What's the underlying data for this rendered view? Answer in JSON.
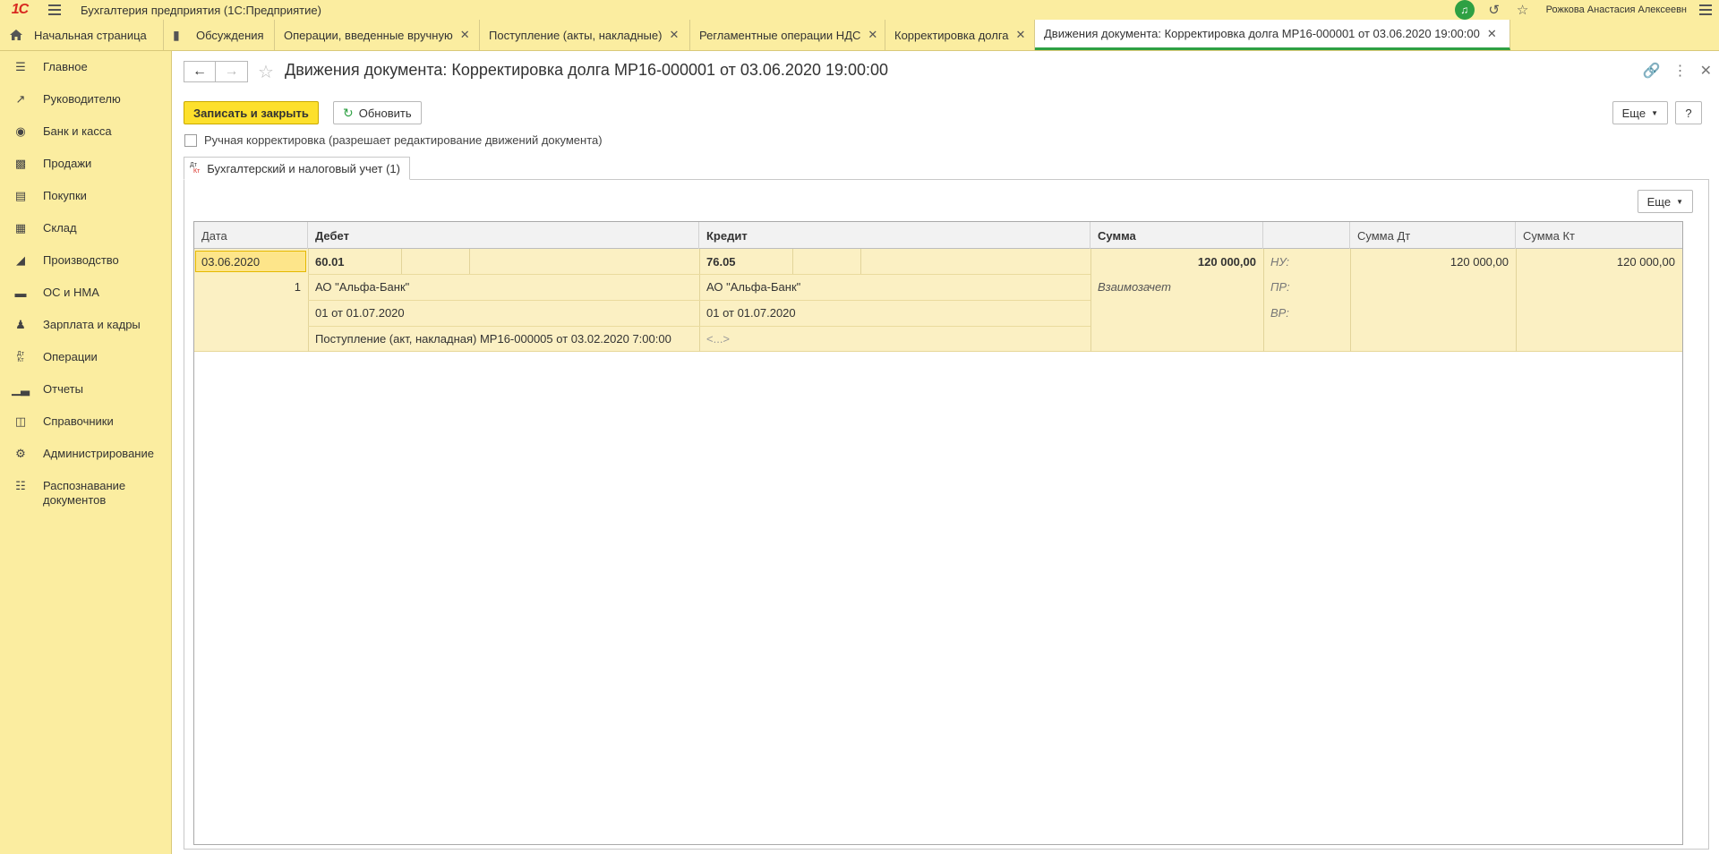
{
  "app": {
    "logo": "1С",
    "title": "Бухгалтерия предприятия  (1С:Предприятие)",
    "user": "Рожкова Анастасия Алексеевн"
  },
  "tabs": [
    {
      "label": "Начальная страница"
    },
    {
      "label": "Обсуждения"
    },
    {
      "label": "Операции, введенные вручную"
    },
    {
      "label": "Поступление (акты, накладные)"
    },
    {
      "label": "Регламентные операции НДС"
    },
    {
      "label": "Корректировка долга"
    },
    {
      "label": "Движения документа: Корректировка долга МР16-000001 от 03.06.2020 19:00:00"
    }
  ],
  "sidebar": {
    "items": [
      {
        "label": "Главное",
        "icon": "menu-icon"
      },
      {
        "label": "Руководителю",
        "icon": "trend-icon"
      },
      {
        "label": "Банк и касса",
        "icon": "coin-icon"
      },
      {
        "label": "Продажи",
        "icon": "bag-icon"
      },
      {
        "label": "Покупки",
        "icon": "cart-icon"
      },
      {
        "label": "Склад",
        "icon": "grid-icon"
      },
      {
        "label": "Производство",
        "icon": "factory-icon"
      },
      {
        "label": "ОС и НМА",
        "icon": "truck-icon"
      },
      {
        "label": "Зарплата и кадры",
        "icon": "person-icon"
      },
      {
        "label": "Операции",
        "icon": "dtkt-icon"
      },
      {
        "label": "Отчеты",
        "icon": "bar-chart-icon"
      },
      {
        "label": "Справочники",
        "icon": "books-icon"
      },
      {
        "label": "Администрирование",
        "icon": "gear-icon"
      },
      {
        "label": "Распознавание документов",
        "icon": "scan-icon"
      }
    ]
  },
  "doc": {
    "title": "Движения документа: Корректировка долга МР16-000001 от 03.06.2020 19:00:00",
    "save_close": "Записать и закрыть",
    "refresh": "Обновить",
    "more": "Еще",
    "help": "?",
    "manual_check": "Ручная корректировка (разрешает редактирование движений документа)",
    "form_tab": "Бухгалтерский и налоговый учет (1)",
    "dt": "Дт",
    "kt": "Кт"
  },
  "table": {
    "headers": {
      "date": "Дата",
      "debit": "Дебет",
      "credit": "Кредит",
      "sum": "Сумма",
      "sum_dt": "Сумма Дт",
      "sum_kt": "Сумма Кт"
    },
    "row": {
      "date": "03.06.2020",
      "num": "1",
      "debit_account": "60.01",
      "debit_sub1": "АО \"Альфа-Банк\"",
      "debit_sub2": "01 от 01.07.2020",
      "debit_sub3": "Поступление (акт, накладная) МР16-000005 от 03.02.2020 7:00:00",
      "credit_account": "76.05",
      "credit_sub1": "АО \"Альфа-Банк\"",
      "credit_sub2": "01 от 01.07.2020",
      "credit_sub3": "<...>",
      "sum": "120 000,00",
      "content": "Взаимозачет",
      "nu": "НУ:",
      "pr": "ПР:",
      "vr": "ВР:",
      "sum_dt": "120 000,00",
      "sum_kt": "120 000,00"
    }
  }
}
